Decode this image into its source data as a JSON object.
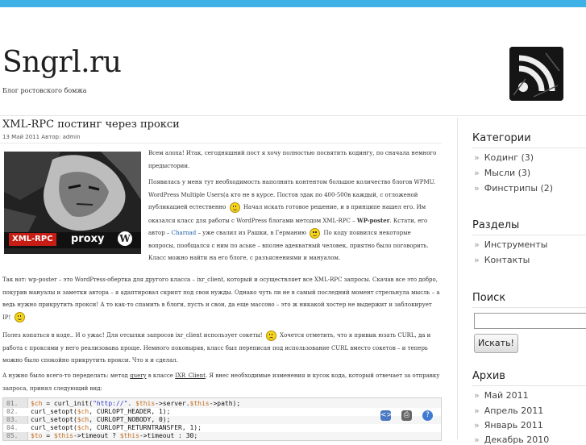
{
  "header": {
    "title": "Sngrl.ru",
    "tagline": "Блог ростовского бомжа",
    "rss_icon": "rss-feed-icon"
  },
  "post": {
    "title": "XML-RPC постинг через прокси",
    "meta": "13 Май 2011 Автор: admin",
    "image": {
      "label_xml": "XML-RPC",
      "label_proxy": "proxy",
      "logo_icon": "wordpress-logo-icon"
    },
    "p1": "Всем алоха! Итак, сегодняшний пост я хочу полностью посвятить кодингу, по сначала немного предыстории.",
    "p2a": "Появилась у меня тут необходимость наполнить контентом большое количество блогов WPMU. WordPress Multiple Users(а кто не в курсе. Постов эдак по 400-500в каждый, с отложеной публикацией естественно",
    "p2b": "Начал искать готовое решение, и в принципе нашел его. Им оказался класс для работы с WordPress блогами методом XML-RPC –",
    "p2_bold": "WP-poster",
    "p2c": ". Кстати, его автор –",
    "p2_link": "Charnad",
    "p2d": "– уже свалил из Рашки, в Германию",
    "p2e": "По коду появился некоторые вопросы, пообщался с ним по аське – вполне адекватный человек, приятно было поговорить. Класс можно найти на его блоге, с разъяснениями и мануалом.",
    "p3a": "Так вот: wp-poster – это WordPress-обертка для другого класса – ixr_client, который и осуществляет все XML-RPC запросы. Скачав все это добро, покурив мануалы и заметки автора – я адаптировал скрипт под свои нужды. Однако чуть ли не в самый последний момент стрельнула мысль – а ведь нужно прикрутить прокси! А то как-то спамить в блоги, пусть и свои, да еще массово – это ж никакой хостер не выдержит и заблокирует IP!",
    "p4a": "Полез копаться в коде.. И о ужас! Для отсылки запросов ixr_client использует сокеты!",
    "p4b": "Хочется отметить, что я привык юзать CURL, да и работа с проксями у него реализована проще. Немного поковыряв, класс был переписан под использование CURL вместо сокетов – и теперь можно было спокойно прикрутить прокси. Что я и сделал.",
    "p5a": "А нужно было всего-то переделать: метод",
    "p5_link1": "query",
    "p5b": "в классе",
    "p5_link2": "IXR_Client",
    "p5c": ". Я внес необходимые изменения и кусок кода, который отвечает за отправку запроса, принял следующий вид:"
  },
  "code": {
    "tools": [
      "view-source-icon",
      "print-icon",
      "help-icon"
    ],
    "lines": [
      {
        "num": "01.",
        "parts": [
          [
            "v",
            "$ch"
          ],
          [
            "t",
            " = curl_init("
          ],
          [
            "s",
            "\"http://\""
          ],
          [
            "t",
            ". "
          ],
          [
            "v",
            "$this"
          ],
          [
            "t",
            "->server."
          ],
          [
            "v",
            "$this"
          ],
          [
            "t",
            "->path);"
          ]
        ]
      },
      {
        "num": "02.",
        "parts": [
          [
            "t",
            "curl_setopt("
          ],
          [
            "v",
            "$ch"
          ],
          [
            "t",
            ", CURLOPT_HEADER, 1);"
          ]
        ]
      },
      {
        "num": "03.",
        "parts": [
          [
            "t",
            "curl_setopt("
          ],
          [
            "v",
            "$ch"
          ],
          [
            "t",
            ", CURLOPT_NOBODY, 0);"
          ]
        ]
      },
      {
        "num": "04.",
        "parts": [
          [
            "t",
            "curl_setopt("
          ],
          [
            "v",
            "$ch"
          ],
          [
            "t",
            ", CURLOPT_RETURNTRANSFER, 1);"
          ]
        ]
      },
      {
        "num": "05.",
        "parts": [
          [
            "v",
            "$to"
          ],
          [
            "t",
            " = "
          ],
          [
            "v",
            "$this"
          ],
          [
            "t",
            "->timeout ? "
          ],
          [
            "v",
            "$this"
          ],
          [
            "t",
            "->timeout : 30;"
          ]
        ]
      }
    ]
  },
  "sidebar": {
    "categories": {
      "heading": "Категории",
      "items": [
        {
          "label": "Кодинг",
          "count": "(3)"
        },
        {
          "label": "Мысли",
          "count": "(3)"
        },
        {
          "label": "Финстрипы",
          "count": "(2)"
        }
      ]
    },
    "sections": {
      "heading": "Разделы",
      "items": [
        "Инструменты",
        "Контакты"
      ]
    },
    "search": {
      "heading": "Поиск",
      "input_value": "",
      "button_label": "Искать!"
    },
    "archive": {
      "heading": "Архив",
      "items": [
        "Май 2011",
        "Апрель 2011",
        "Январь 2011",
        "Декабрь 2010"
      ]
    }
  },
  "colors": {
    "topbar": "#3eb2e6",
    "link": "#1c5fa6"
  }
}
